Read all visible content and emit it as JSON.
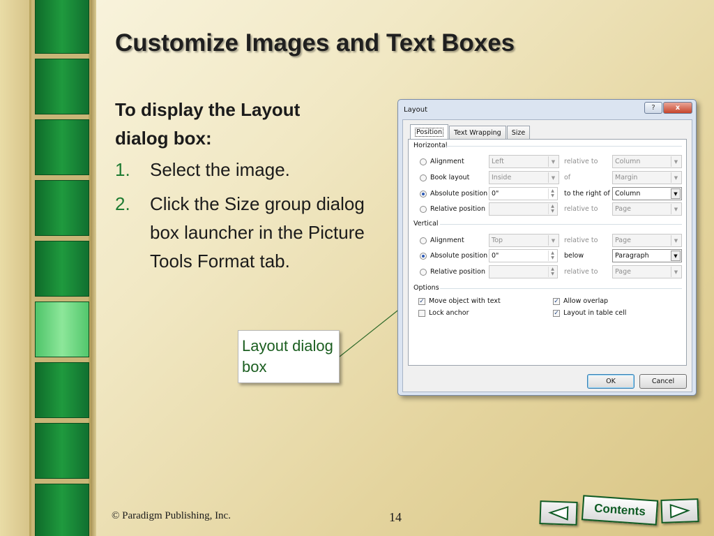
{
  "slide": {
    "title": "Customize Images and Text Boxes",
    "subhead": "To display the Layout dialog box:",
    "steps": [
      {
        "num": "1.",
        "text": "Select the image."
      },
      {
        "num": "2.",
        "text": "Click the Size group dialog box launcher in the Picture Tools Format tab."
      }
    ],
    "callout": "Layout dialog box",
    "copyright": "© Paradigm Publishing, Inc.",
    "page_number": "14",
    "nav": {
      "contents": "Contents",
      "prev_icon": "triangle-left-icon",
      "next_icon": "triangle-right-icon"
    }
  },
  "dialog": {
    "title": "Layout",
    "help_glyph": "?",
    "close_glyph": "x",
    "tabs": [
      "Position",
      "Text Wrapping",
      "Size"
    ],
    "active_tab": "Position",
    "horizontal": {
      "label": "Horizontal",
      "rows": [
        {
          "option": "Alignment",
          "value": "Left",
          "rel_label": "relative to",
          "rel_value": "Column",
          "selected": false
        },
        {
          "option": "Book layout",
          "value": "Inside",
          "rel_label": "of",
          "rel_value": "Margin",
          "selected": false
        },
        {
          "option": "Absolute position",
          "value": "0\"",
          "rel_label": "to the right of",
          "rel_value": "Column",
          "selected": true
        },
        {
          "option": "Relative position",
          "value": "",
          "rel_label": "relative to",
          "rel_value": "Page",
          "selected": false
        }
      ]
    },
    "vertical": {
      "label": "Vertical",
      "rows": [
        {
          "option": "Alignment",
          "value": "Top",
          "rel_label": "relative to",
          "rel_value": "Page",
          "selected": false
        },
        {
          "option": "Absolute position",
          "value": "0\"",
          "rel_label": "below",
          "rel_value": "Paragraph",
          "selected": true
        },
        {
          "option": "Relative position",
          "value": "",
          "rel_label": "relative to",
          "rel_value": "Page",
          "selected": false
        }
      ]
    },
    "options": {
      "label": "Options",
      "move_object": "Move object with text",
      "lock_anchor": "Lock anchor",
      "allow_overlap": "Allow overlap",
      "layout_in_cell": "Layout in table cell"
    },
    "buttons": {
      "ok": "OK",
      "cancel": "Cancel"
    }
  },
  "colors": {
    "accent_green": "#1e7b32",
    "strip_green": "#1f9a3e",
    "dialog_bg": "#dbe4f1"
  }
}
